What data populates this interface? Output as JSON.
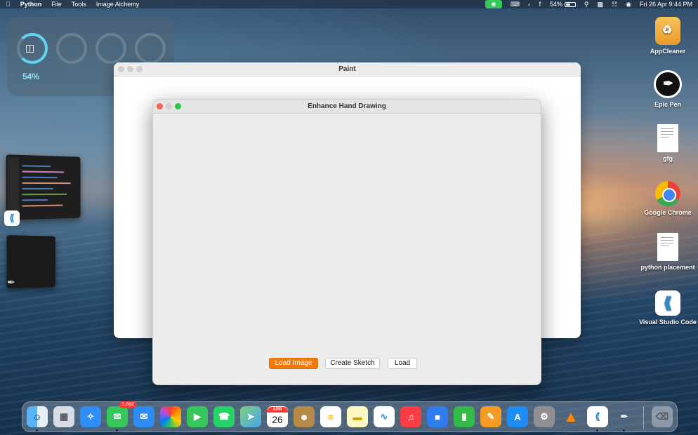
{
  "menubar": {
    "apple_icon": "apple-icon",
    "app_name": "Python",
    "menus": [
      "File",
      "Tools",
      "Image Alchemy"
    ],
    "battery_percent": "54%",
    "battery_level": 0.54,
    "datetime": "Fri 26 Apr  9:44 PM",
    "status_icons": [
      "facetime-icon",
      "keyboard-icon",
      "chevron-left-icon",
      "bluetooth-icon",
      "search-icon",
      "notification-icon",
      "control-center-icon",
      "siri-icon"
    ]
  },
  "widget": {
    "battery_percent": "54%",
    "battery_level": 0.54
  },
  "paint_window": {
    "title": "Paint"
  },
  "enhance_window": {
    "title": "Enhance Hand Drawing",
    "buttons": {
      "load_image": "Load Image",
      "create_sketch": "Create Sketch",
      "load": "Load"
    },
    "accent_color": "#f07a0e"
  },
  "desktop_icons": [
    {
      "label": "AppCleaner"
    },
    {
      "label": "Epic Pen"
    },
    {
      "label": "gfg"
    },
    {
      "label": "Google Chrome"
    },
    {
      "label": "python placement"
    },
    {
      "label": "Visual Studio Code"
    }
  ],
  "dock": {
    "messages_badge": "1,562",
    "calendar_month": "APR",
    "calendar_day": "26",
    "apps": [
      "finder-icon",
      "launchpad-icon",
      "safari-icon",
      "messages-icon",
      "mail-icon",
      "photos-icon",
      "facetime-icon",
      "whatsapp-icon",
      "maps-icon",
      "calendar-icon",
      "contacts-icon",
      "reminders-icon",
      "notes-icon",
      "freeform-icon",
      "music-icon",
      "keynote-icon",
      "numbers-icon",
      "pages-icon",
      "app-store-icon",
      "system-settings-icon",
      "vlc-icon",
      "vscode-icon",
      "epic-pen-icon",
      "trash-icon"
    ]
  }
}
